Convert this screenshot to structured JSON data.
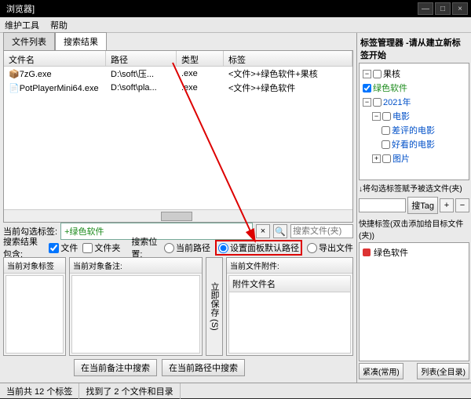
{
  "titlebar": {
    "title": "浏览器]"
  },
  "menu": {
    "maintain": "维护工具",
    "help": "帮助"
  },
  "tabs": {
    "list": "文件列表",
    "search": "搜索结果"
  },
  "grid": {
    "headers": {
      "name": "文件名",
      "path": "路径",
      "type": "类型",
      "tag": "标签"
    },
    "rows": [
      {
        "name": "7zG.exe",
        "path": "D:\\soft\\压...",
        "type": ".exe",
        "tag": "<文件>+绿色软件+果核"
      },
      {
        "name": "PotPlayerMini64.exe",
        "path": "D:\\soft\\pla...",
        "type": ".exe",
        "tag": "<文件>+绿色软件"
      }
    ]
  },
  "mid": {
    "curTagLabel": "当前勾选标签:",
    "curTagValue": "+绿色软件",
    "searchPlaceholder": "搜索文件(夹)",
    "includeLabel": "搜索结果包含:",
    "cbFile": "文件",
    "cbFolder": "文件夹",
    "locLabel": "搜索位置:",
    "rCur": "当前路径",
    "rDef": "设置面板默认路径",
    "rExp": "导出文件"
  },
  "panels": {
    "p1": "当前对象标签",
    "p2": "当前对象备注:",
    "p3": "当前文件附件:",
    "p3col": "附件文件名",
    "vbtn": "立即保存 (S)"
  },
  "btns": {
    "b1": "在当前备注中搜索",
    "b2": "在当前路径中搜索"
  },
  "status": {
    "s1": "当前共 12 个标签",
    "s2": "找到了 2 个文件和目录"
  },
  "right": {
    "title": "标签管理器 -请从建立新标签开始",
    "tree": {
      "n1": "果核",
      "n2": "绿色软件",
      "n3": "2021年",
      "n4": "电影",
      "n5": "差评的电影",
      "n6": "好看的电影",
      "n7": "图片"
    },
    "assign": "↓将勾选标签赋予被选文件(夹)",
    "searchTag": "搜Tag",
    "quick": "快捷标签(双击添加给目标文件(夹))",
    "chip": "绿色软件",
    "rb1": "紧凑(常用)",
    "rb2": "列表(全目录)"
  }
}
